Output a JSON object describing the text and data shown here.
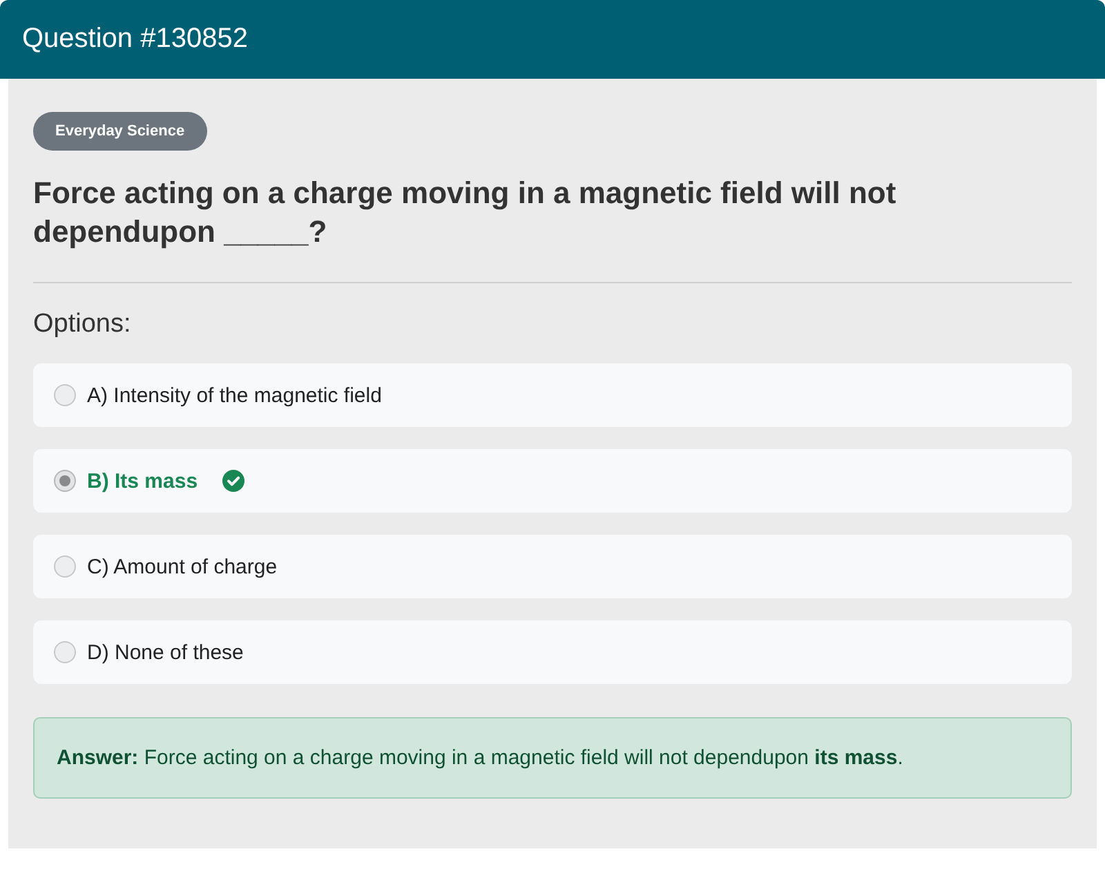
{
  "header": {
    "title": "Question #130852"
  },
  "category_badge": "Everyday Science",
  "question": "Force acting on a charge moving in a magnetic field will not dependupon _____?",
  "options_label": "Options:",
  "options": [
    {
      "text": "A) Intensity of the magnetic field",
      "selected": false,
      "correct": false
    },
    {
      "text": "B) Its mass",
      "selected": true,
      "correct": true
    },
    {
      "text": "C) Amount of charge",
      "selected": false,
      "correct": false
    },
    {
      "text": "D) None of these",
      "selected": false,
      "correct": false
    }
  ],
  "answer": {
    "text": "**Answer:** Force acting on a charge moving in a magnetic field will not dependupon **its mass**."
  }
}
